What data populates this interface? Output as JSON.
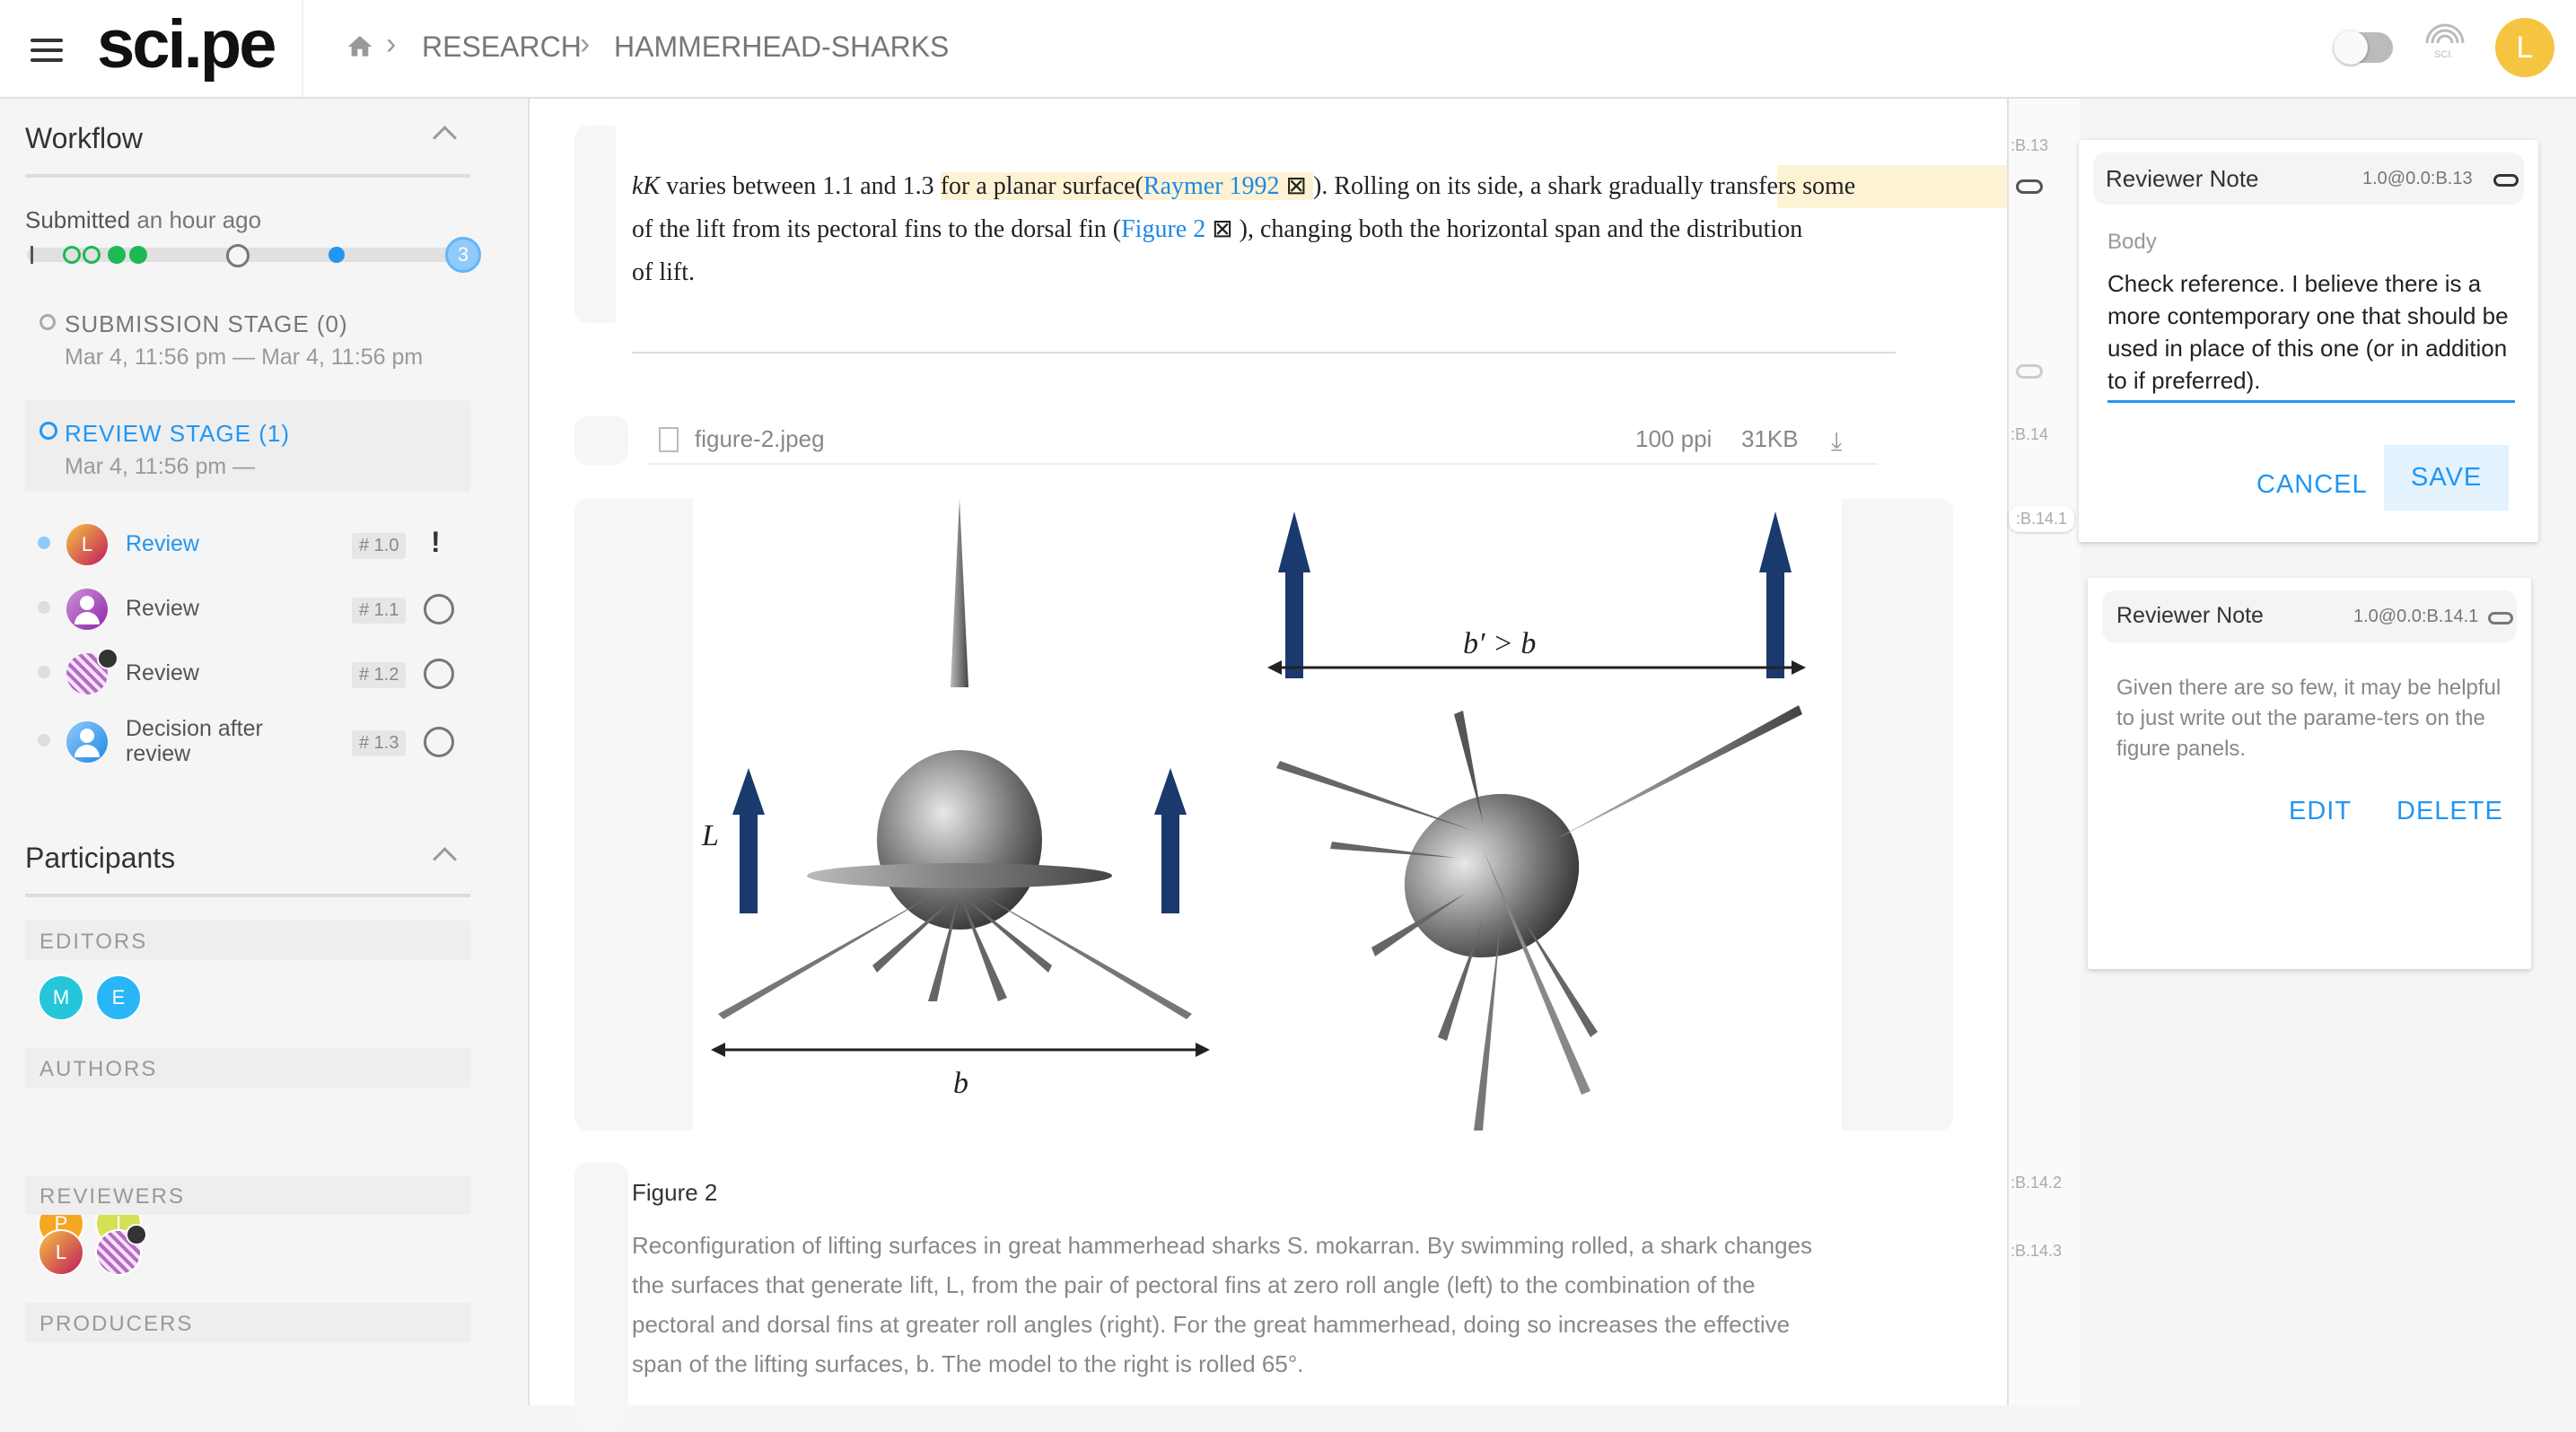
{
  "app": {
    "logo": "sci.pe"
  },
  "breadcrumb": {
    "items": [
      "RESEARCH",
      "HAMMERHEAD-SHARKS"
    ]
  },
  "header": {
    "user_initial": "L"
  },
  "sidebar": {
    "workflow": {
      "title": "Workflow",
      "submitted_label": "Submitted",
      "submitted_time": "an hour ago",
      "progress_badge": "3",
      "submission_stage": {
        "label": "SUBMISSION STAGE (0)",
        "dates": "Mar 4, 11:56 pm — Mar 4, 11:56 pm"
      },
      "review_stage": {
        "label": "REVIEW STAGE (1)",
        "dates": "Mar 4, 11:56 pm —"
      },
      "steps": [
        {
          "label": "Review",
          "tag": "# 1.0",
          "status": "!",
          "avatar": "L"
        },
        {
          "label": "Review",
          "tag": "# 1.1",
          "avatar": ""
        },
        {
          "label": "Review",
          "tag": "# 1.2",
          "avatar": ""
        },
        {
          "label": "Decision after review",
          "tag": "# 1.3",
          "avatar": ""
        }
      ]
    },
    "participants": {
      "title": "Participants",
      "editors_label": "EDITORS",
      "editors": [
        "M",
        "E"
      ],
      "authors_label": "AUTHORS",
      "authors": [
        "P",
        "I"
      ],
      "reviewers_label": "REVIEWERS",
      "reviewers": [
        "L"
      ],
      "producers_label": "PRODUCERS"
    }
  },
  "document": {
    "para1": {
      "kk": "kK",
      "t1": " varies between 1.1 and 1.3 ",
      "hl": "for a planar surface",
      "ref1": "Raymer 1992",
      "t2": "). Rolling on its side, a shark gradually transfers some",
      "line2a": "of the lift from its pectoral fins to the dorsal fin (",
      "ref2": "Figure 2",
      "line2b": "), changing both the horizontal span and the distribution",
      "line3": "of lift."
    },
    "file": {
      "name": "figure-2.jpeg",
      "ppi": "100 ppi",
      "size": "31KB"
    },
    "figure_labels": {
      "L": "L",
      "b": "b",
      "bprime": "b′ > b"
    },
    "figure_caption": {
      "title": "Figure 2",
      "lines": [
        "Reconfiguration of lifting surfaces in great hammerhead sharks S. mokarran. By swimming rolled, a shark changes",
        "the surfaces that generate lift, L, from the pair of pectoral fins at zero roll angle (left) to the combination of the",
        "pectoral and dorsal fins at greater roll angles (right). For the great hammerhead, doing so increases the effective",
        "span of the lifting surfaces, b. The model to the right is rolled 65°."
      ]
    }
  },
  "markers": {
    "m1": ":B.13",
    "m2": ":B.14",
    "m3": ":B.14.1",
    "m4": ":B.14.2",
    "m5": ":B.14.3"
  },
  "notes": {
    "note1": {
      "title": "Reviewer Note",
      "id": "1.0@0.0:B.13",
      "body_label": "Body",
      "body": "Check reference. I believe there is a more contemporary one that should be used in place of this one (or in addition to if preferred).",
      "cancel": "CANCEL",
      "save": "SAVE"
    },
    "note2": {
      "title": "Reviewer Note",
      "id": "1.0@0.0:B.14.1",
      "body": "Given there are so few, it may be helpful to just write out the parame-ters on the figure panels.",
      "edit": "EDIT",
      "delete": "DELETE"
    }
  }
}
